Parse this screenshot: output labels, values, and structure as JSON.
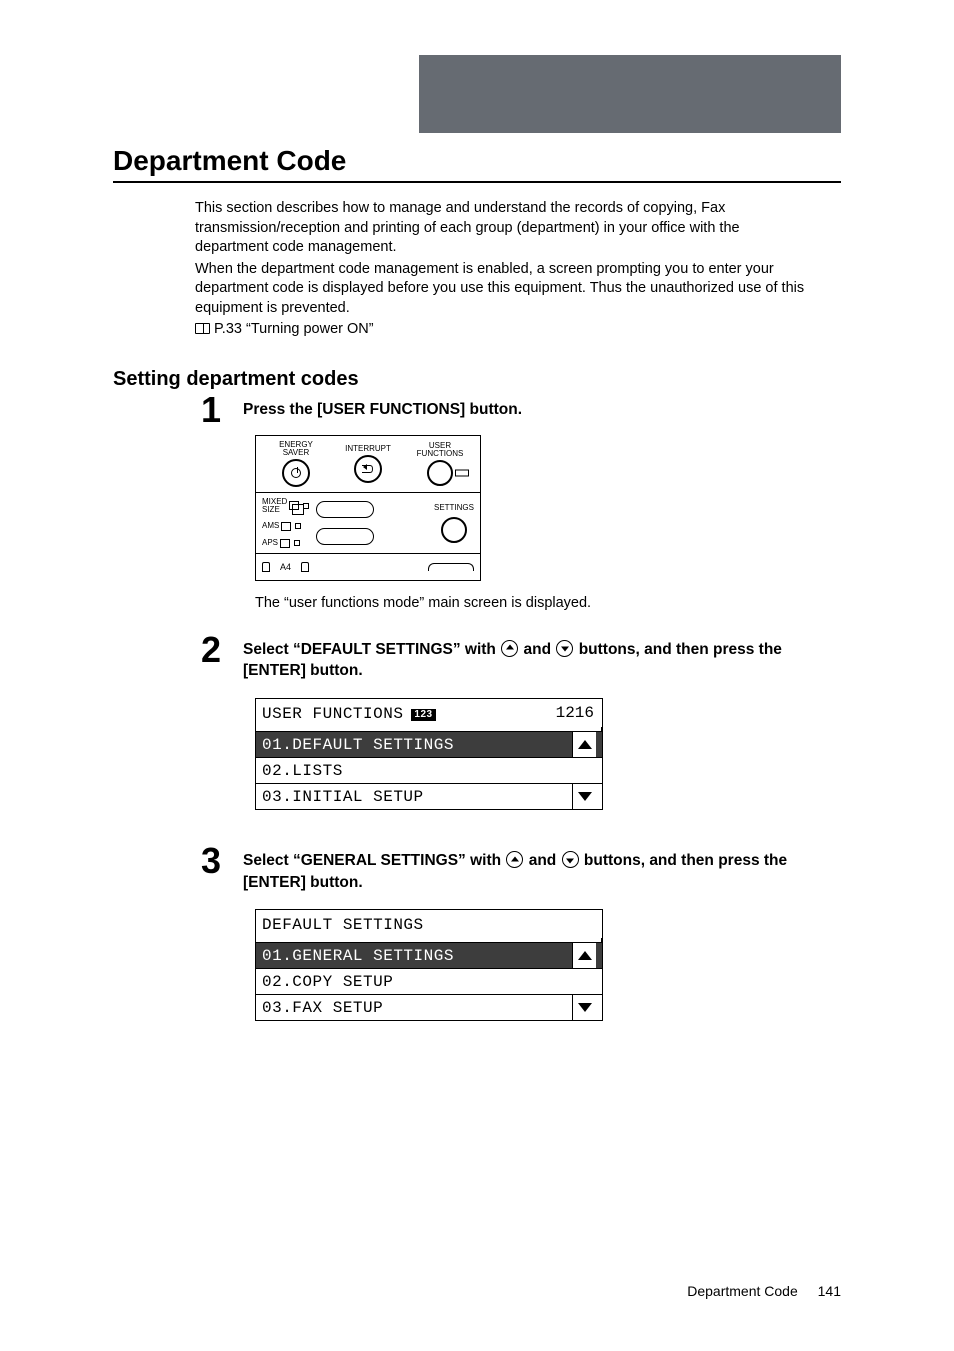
{
  "heading": "Department Code",
  "intro": {
    "p1": "This section describes how to manage and understand the records of copying, Fax transmission/reception and printing of each group (department) in your office with the department code management.",
    "p2": "When the department code management is enabled, a screen prompting you to enter your department code is displayed before you use this equipment. Thus the unauthorized use of this equipment is prevented.",
    "ref": "P.33 “Turning power ON”"
  },
  "subheading": "Setting department codes",
  "steps": {
    "s1": {
      "num": "1",
      "title": "Press the [USER FUNCTIONS] button.",
      "panel": {
        "energy_saver": "ENERGY",
        "energy_saver2": "SAVER",
        "interrupt": "INTERRUPT",
        "user_functions": "USER",
        "user_functions2": "FUNCTIONS",
        "mixed_size": "MIXED",
        "mixed_size2": "SIZE",
        "ams": "AMS",
        "aps": "APS",
        "settings": "SETTINGS",
        "a4": "A4"
      },
      "note": "The “user functions mode” main screen is displayed."
    },
    "s2": {
      "num": "2",
      "title_a": "Select “DEFAULT SETTINGS” with ",
      "title_mid": " and ",
      "title_b": " buttons, and then press the [ENTER] button.",
      "menu": {
        "header": "USER FUNCTIONS",
        "header_num": "1216",
        "items": [
          "01.DEFAULT SETTINGS",
          "02.LISTS",
          "03.INITIAL SETUP"
        ]
      }
    },
    "s3": {
      "num": "3",
      "title_a": "Select “GENERAL SETTINGS” with ",
      "title_mid": " and ",
      "title_b": " buttons, and then press the [ENTER] button.",
      "menu": {
        "header": "DEFAULT SETTINGS",
        "items": [
          "01.GENERAL SETTINGS",
          "02.COPY SETUP",
          "03.FAX SETUP"
        ]
      }
    }
  },
  "footer": {
    "label": "Department Code",
    "page": "141"
  }
}
